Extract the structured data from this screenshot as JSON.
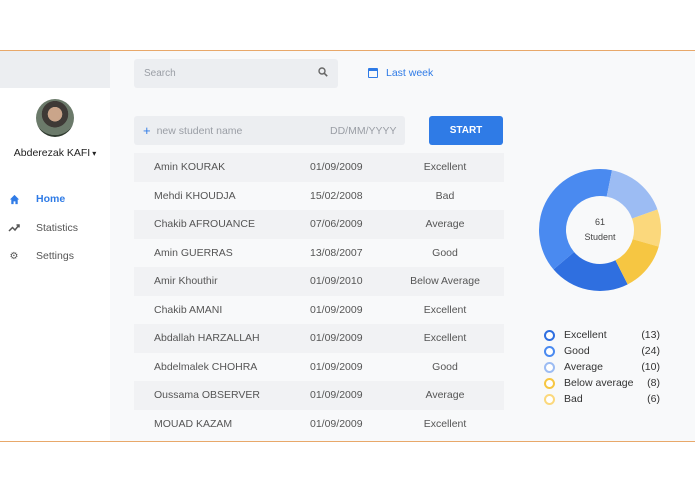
{
  "sidebar": {
    "user_name": "Abderezak KAFI",
    "items": [
      {
        "label": "Home",
        "icon": "home-icon",
        "active": true
      },
      {
        "label": "Statistics",
        "icon": "trend-icon",
        "active": false
      },
      {
        "label": "Settings",
        "icon": "gear-icon",
        "active": false
      }
    ]
  },
  "header": {
    "search_placeholder": "Search",
    "period_label": "Last week"
  },
  "new_student": {
    "name_placeholder": "new student name",
    "date_placeholder": "DD/MM/YYYY",
    "start_label": "START"
  },
  "students": [
    {
      "name": "Amin KOURAK",
      "date": "01/09/2009",
      "grade": "Excellent"
    },
    {
      "name": "Mehdi KHOUDJA",
      "date": "15/02/2008",
      "grade": "Bad"
    },
    {
      "name": "Chakib AFROUANCE",
      "date": "07/06/2009",
      "grade": "Average"
    },
    {
      "name": "Amin GUERRAS",
      "date": "13/08/2007",
      "grade": "Good"
    },
    {
      "name": "Amir Khouthir",
      "date": "01/09/2010",
      "grade": "Below Average"
    },
    {
      "name": "Chakib AMANI",
      "date": "01/09/2009",
      "grade": "Excellent"
    },
    {
      "name": "Abdallah HARZALLAH",
      "date": "01/09/2009",
      "grade": "Excellent"
    },
    {
      "name": "Abdelmalek CHOHRA",
      "date": "01/09/2009",
      "grade": "Good"
    },
    {
      "name": "Oussama OBSERVER",
      "date": "01/09/2009",
      "grade": "Average"
    },
    {
      "name": "MOUAD KAZAM",
      "date": "01/09/2009",
      "grade": "Excellent"
    }
  ],
  "summary": {
    "total": "61",
    "total_label": "Student"
  },
  "chart_data": {
    "type": "pie",
    "categories": [
      "Excellent",
      "Good",
      "Average",
      "Below average",
      "Bad"
    ],
    "values": [
      13,
      24,
      10,
      8,
      6
    ],
    "colors": [
      "#2f6fe0",
      "#4a8af0",
      "#9cbcf3",
      "#f6c642",
      "#fbd87c"
    ]
  }
}
